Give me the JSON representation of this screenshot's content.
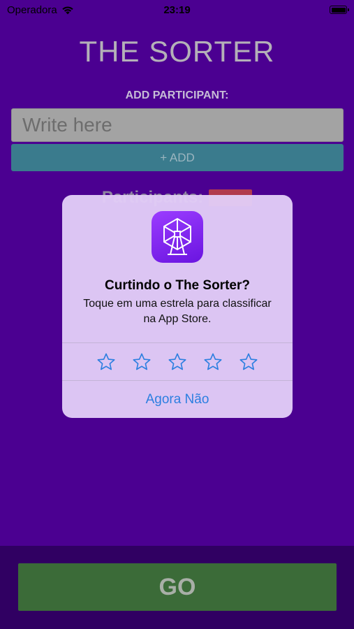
{
  "status_bar": {
    "carrier": "Operadora",
    "time": "23:19"
  },
  "app": {
    "title": "THE SORTER",
    "add_label": "ADD PARTICIPANT:",
    "input_placeholder": "Write here",
    "add_button_label": "+ ADD",
    "participants_label": "Participants:",
    "go_button_label": "GO"
  },
  "alert": {
    "title": "Curtindo o The Sorter?",
    "message": "Toque em uma estrela para classificar na App Store.",
    "dismiss_label": "Agora Não",
    "star_count": 5
  },
  "colors": {
    "background": "#4b0091",
    "bottom_bar": "#300062",
    "add_button": "#3a7b8d",
    "go_button": "#3b6b38",
    "alert_tint": "#2c7fe0",
    "clear_badge": "#b13a4d"
  },
  "icons": [
    "wifi-icon",
    "battery-icon",
    "app-icon-ferris-wheel",
    "star-icon"
  ]
}
